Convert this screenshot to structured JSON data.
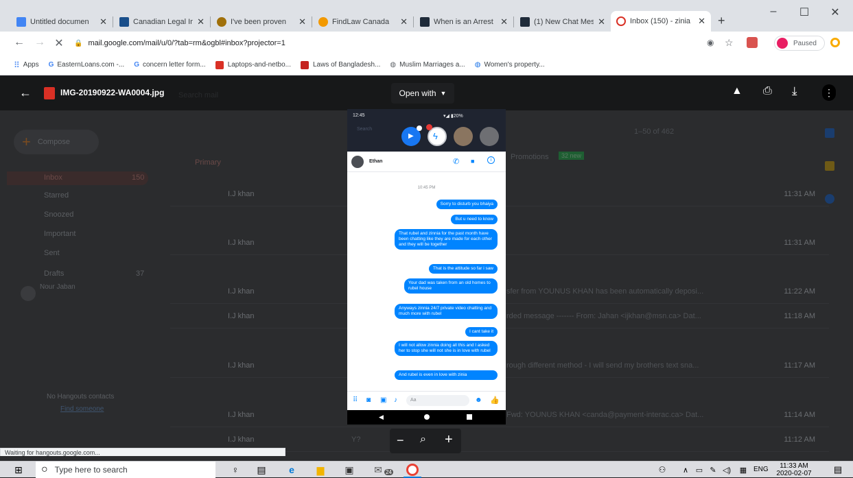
{
  "browser": {
    "tabs": [
      {
        "label": "Untitled documen",
        "favicon_color": "#4285f4"
      },
      {
        "label": "Canadian Legal In",
        "favicon_color": "#1a4f8b"
      },
      {
        "label": "I've been proven",
        "favicon_color": "#a0700a"
      },
      {
        "label": "FindLaw Canada",
        "favicon_color": "#f29900"
      },
      {
        "label": "When is an Arrest",
        "favicon_color": "#1f2b3a"
      },
      {
        "label": "(1) New Chat Mes",
        "favicon_color": "#1f2b3a"
      },
      {
        "label": "Inbox (150) - zinia",
        "favicon_color": "#d93025"
      }
    ],
    "new_tab_label": "+",
    "window_controls": {
      "minimize": "–",
      "maximize": "☐",
      "close": "✕"
    },
    "url": "mail.google.com/mail/u/0/?tab=rm&ogbl#inbox?projector=1",
    "profile_label": "Paused",
    "bookmarks": [
      {
        "label": "Apps",
        "icon": "apps-grid-icon"
      },
      {
        "label": "EasternLoans.com -...",
        "icon": "google-icon"
      },
      {
        "label": "concern letter form...",
        "icon": "google-icon"
      },
      {
        "label": "Laptops-and-netbo...",
        "icon": "red-bookmark-icon"
      },
      {
        "label": "Laws of Bangladesh...",
        "icon": "red-bookmark-icon"
      },
      {
        "label": "Muslim Marriages a...",
        "icon": "globe-icon"
      },
      {
        "label": "Women's property...",
        "icon": "globe-icon"
      }
    ]
  },
  "viewer": {
    "filename": "IMG-20190922-WA0004.jpg",
    "open_with_label": "Open with",
    "zoom_minus": "−",
    "zoom_plus": "+"
  },
  "gmail_background": {
    "compose_label": "Compose",
    "search_placeholder": "Search mail",
    "pagination": "1–50 of 462",
    "sidebar": [
      {
        "label": "Inbox",
        "count": "150"
      },
      {
        "label": "Starred",
        "count": ""
      },
      {
        "label": "Snoozed",
        "count": ""
      },
      {
        "label": "Important",
        "count": ""
      },
      {
        "label": "Sent",
        "count": ""
      },
      {
        "label": "Drafts",
        "count": "37"
      }
    ],
    "hangouts_user": "Nour Jaban",
    "hangouts_status": "No Hangouts contacts",
    "find_someone": "Find someone",
    "primary_tab": "Primary",
    "promotions_tab": "Promotions",
    "promotions_badge": "32 new",
    "status_bar": "Waiting for hangouts.google.com...",
    "rows": [
      {
        "sender": "I.J khan",
        "snippet": "",
        "time": "11:31 AM"
      },
      {
        "sender": "I.J khan",
        "snippet": "",
        "time": "11:31 AM"
      },
      {
        "sender": "I.J khan",
        "snippet": "sfer from YOUNUS KHAN has been automatically deposi...",
        "time": "11:22 AM"
      },
      {
        "sender": "I.J khan",
        "snippet": "rded message ------- From: Jahan <ijkhan@msn.ca> Dat...",
        "time": "11:18 AM"
      },
      {
        "sender": "I.J khan",
        "snippet": "rough different method - I will send my brothers text sna...",
        "time": "11:17 AM"
      },
      {
        "sender": "I.J khan",
        "snippet": "Fwd: YOUNUS KHAN <canda@payment-interac.ca> Dat...",
        "time": "11:14 AM"
      },
      {
        "sender": "I.J khan",
        "snippet": "Y?",
        "time": "11:12 AM"
      }
    ]
  },
  "phone": {
    "status_time": "12:45",
    "status_right": "▾◢ ▮20%",
    "search_label": "Search",
    "contact_name": "Ethan",
    "timestamp": "10:45 PM",
    "messages": [
      "Sorry to disturb you bhaiya",
      "But u need to know",
      "That rubel and zinnia for the past month have been chatting like they are made for each other and they will be together",
      "That is the attitude so far i saw",
      "Your dad was taken from an old homes to rubel house",
      "Anyways zinnia 24/7 private video chatting and much more with rubel",
      "I cant take it",
      "I will not allow zinnia doing all this and I asked her to stop she will not she is in love with rubel",
      "And rubel is even in love with zinia"
    ],
    "input_placeholder": "Aa"
  },
  "taskbar": {
    "search_placeholder": "Type here to search",
    "store_badge": "24",
    "language": "ENG",
    "time": "11:33 AM",
    "date": "2020-02-07"
  },
  "colors": {
    "messenger_blue": "#0084ff",
    "viewer_dark": "#2b2c2e",
    "chrome_tabstrip": "#dee1e6"
  }
}
